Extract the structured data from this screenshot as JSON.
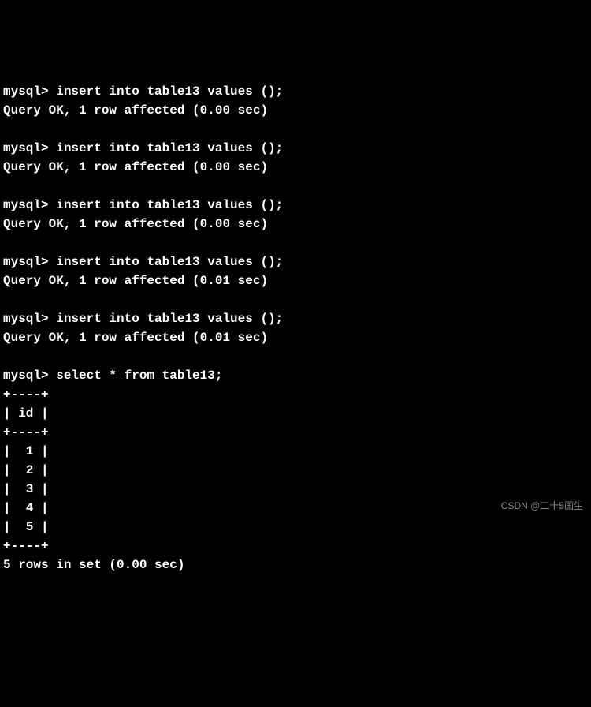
{
  "terminal": {
    "prompt": "mysql>",
    "inserts": [
      {
        "cmd": "insert into table13 values ();",
        "result": "Query OK, 1 row affected (0.00 sec)"
      },
      {
        "cmd": "insert into table13 values ();",
        "result": "Query OK, 1 row affected (0.00 sec)"
      },
      {
        "cmd": "insert into table13 values ();",
        "result": "Query OK, 1 row affected (0.00 sec)"
      },
      {
        "cmd": "insert into table13 values ();",
        "result": "Query OK, 1 row affected (0.01 sec)"
      },
      {
        "cmd": "insert into table13 values ();",
        "result": "Query OK, 1 row affected (0.01 sec)"
      }
    ],
    "select": {
      "cmd": "select * from table13;",
      "border": "+----+",
      "header": "| id |",
      "rows": [
        "|  1 |",
        "|  2 |",
        "|  3 |",
        "|  4 |",
        "|  5 |"
      ],
      "summary": "5 rows in set (0.00 sec)"
    }
  },
  "watermark": "CSDN @二十5画生"
}
